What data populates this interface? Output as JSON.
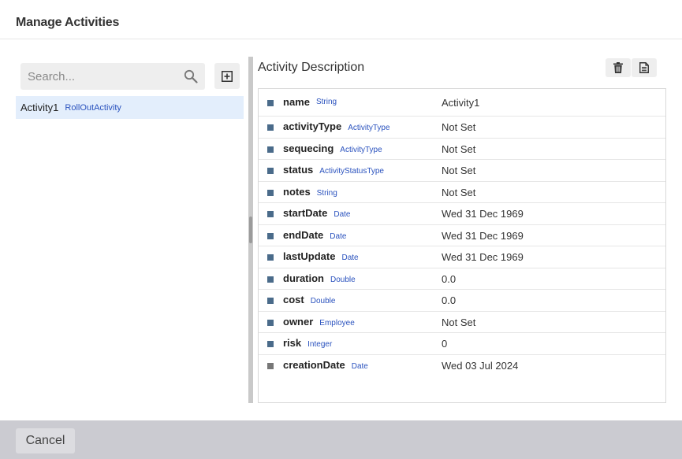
{
  "header": {
    "title": "Manage Activities"
  },
  "search": {
    "placeholder": "Search..."
  },
  "activities": [
    {
      "name": "Activity1",
      "type": "RollOutActivity"
    }
  ],
  "description": {
    "title": "Activity Description",
    "properties": [
      {
        "name": "name",
        "type": "String",
        "value": "Activity1"
      },
      {
        "name": "activityType",
        "type": "ActivityType",
        "value": "Not Set"
      },
      {
        "name": "sequecing",
        "type": "ActivityType",
        "value": "Not Set"
      },
      {
        "name": "status",
        "type": "ActivityStatusType",
        "value": "Not Set"
      },
      {
        "name": "notes",
        "type": "String",
        "value": "Not Set"
      },
      {
        "name": "startDate",
        "type": "Date",
        "value": "Wed 31 Dec 1969"
      },
      {
        "name": "endDate",
        "type": "Date",
        "value": "Wed 31 Dec 1969"
      },
      {
        "name": "lastUpdate",
        "type": "Date",
        "value": "Wed 31 Dec 1969"
      },
      {
        "name": "duration",
        "type": "Double",
        "value": "0.0"
      },
      {
        "name": "cost",
        "type": "Double",
        "value": "0.0"
      },
      {
        "name": "owner",
        "type": "Employee",
        "value": "Not Set"
      },
      {
        "name": "risk",
        "type": "Integer",
        "value": "0"
      },
      {
        "name": "creationDate",
        "type": "Date",
        "value": "Wed 03 Jul 2024"
      }
    ]
  },
  "footer": {
    "cancel_label": "Cancel"
  },
  "colors": {
    "selection": "#e3eefc",
    "type_label": "#2a52be",
    "footer": "#cbcbd1"
  },
  "icons": {
    "search": "search-icon",
    "add": "add-box-icon",
    "delete": "trash-icon",
    "document": "document-icon"
  }
}
